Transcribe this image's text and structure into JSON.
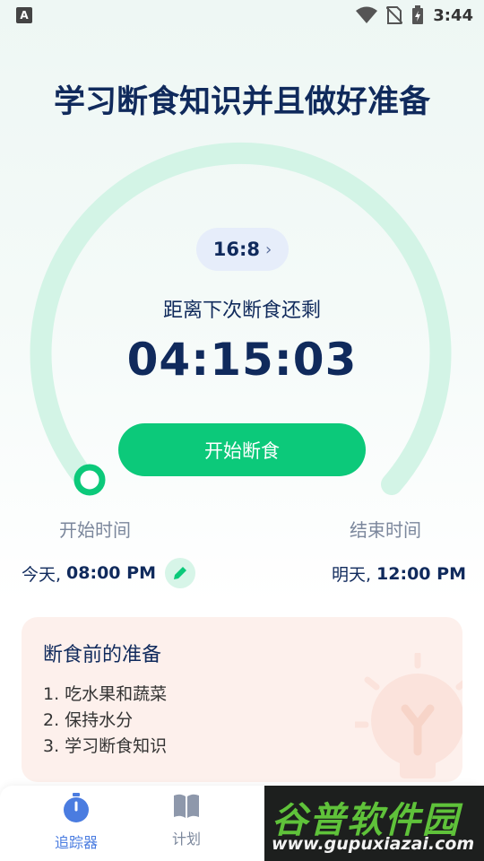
{
  "status_bar": {
    "time": "3:44",
    "left_icon_letter": "A"
  },
  "page": {
    "title": "学习断食知识并且做好准备"
  },
  "timer": {
    "plan_label": "16:8",
    "countdown_label": "距离下次断食还剩",
    "countdown": "04:15:03",
    "start_button": "开始断食",
    "progress_fraction": 0.0
  },
  "times": {
    "start": {
      "label": "开始时间",
      "day": "今天,",
      "time": "08:00 PM"
    },
    "end": {
      "label": "结束时间",
      "day": "明天,",
      "time": "12:00 PM"
    }
  },
  "prep": {
    "title": "断食前的准备",
    "items": [
      "1. 吃水果和蔬菜",
      "2. 保持水分",
      "3. 学习断食知识"
    ]
  },
  "tabs": [
    {
      "label": "追踪器",
      "icon": "stopwatch-icon",
      "active": true
    },
    {
      "label": "计划",
      "icon": "book-icon",
      "active": false
    }
  ],
  "watermark": {
    "title": "谷普软件园",
    "url": "www.gupuxiazai.com"
  },
  "colors": {
    "accent_green": "#0cc97a",
    "ring_track": "#d3f4e6",
    "title_navy": "#102a5c",
    "tab_active": "#4a7ce0",
    "card_bg": "#fdf0ec"
  }
}
